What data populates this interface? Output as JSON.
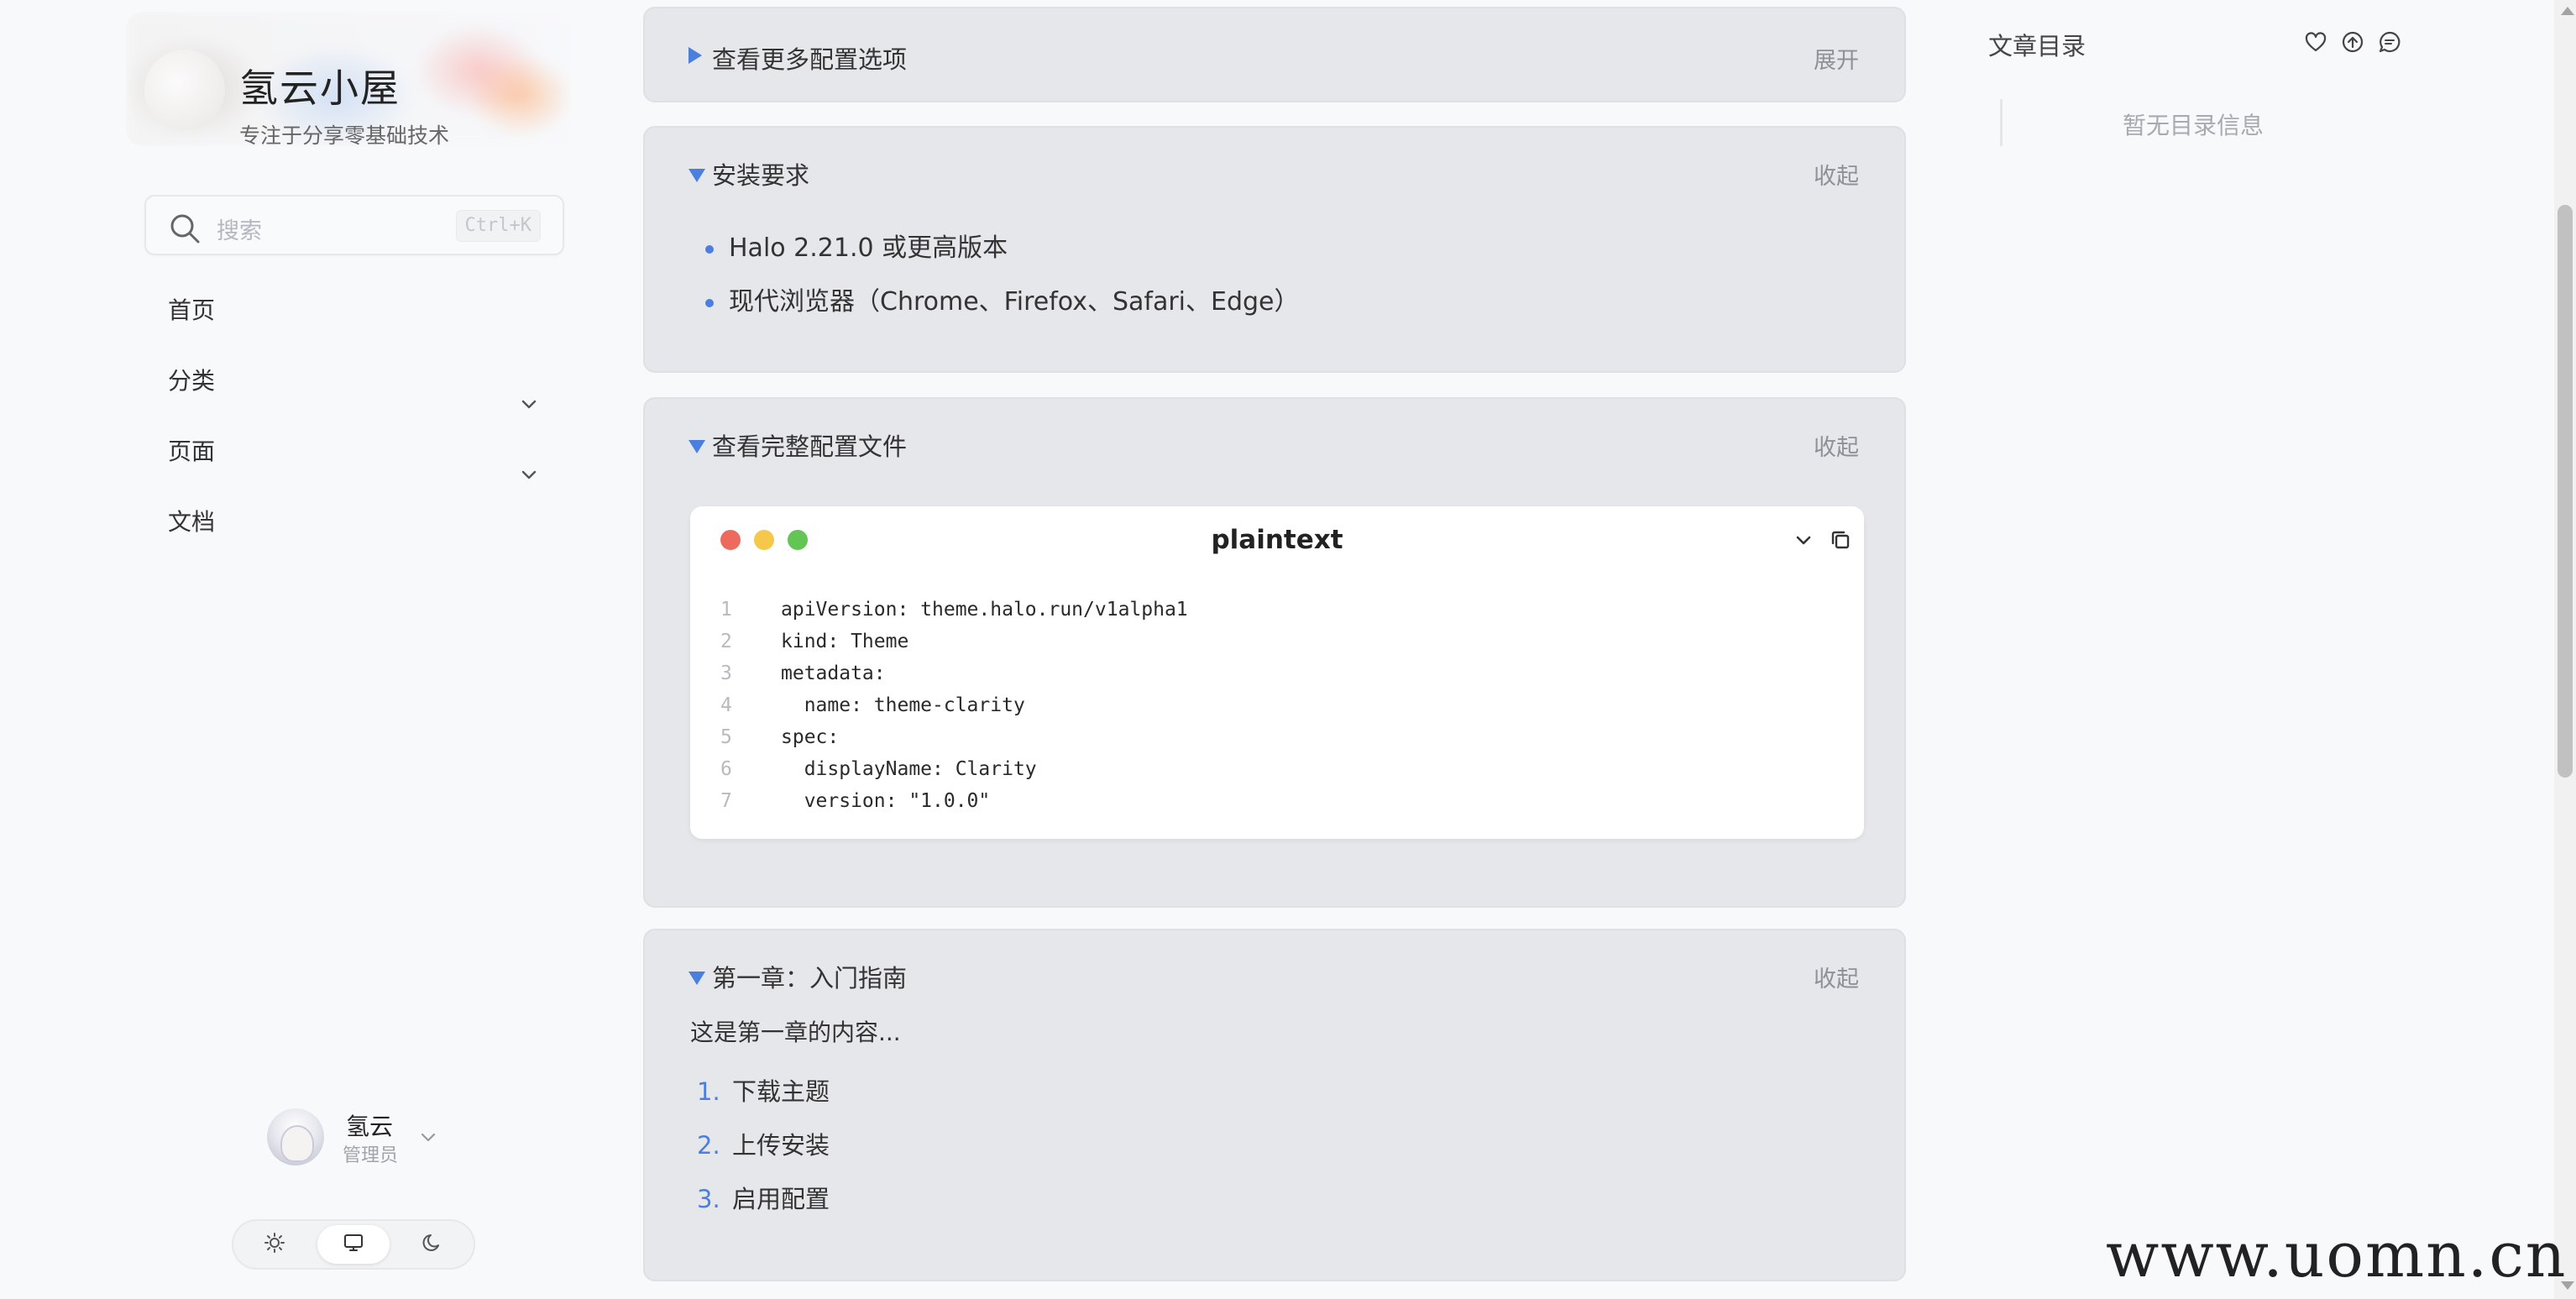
{
  "site": {
    "title": "氢云小屋",
    "subtitle": "专注于分享零基础技术"
  },
  "search": {
    "placeholder": "搜索",
    "shortcut": "Ctrl+K"
  },
  "nav": {
    "items": [
      {
        "label": "首页",
        "has_children": false
      },
      {
        "label": "分类",
        "has_children": true
      },
      {
        "label": "页面",
        "has_children": true
      },
      {
        "label": "文档",
        "has_children": false
      }
    ]
  },
  "user": {
    "name": "氢云",
    "role": "管理员"
  },
  "theme_switch": {
    "options": [
      "light-icon",
      "system-icon",
      "dark-icon"
    ],
    "selected": "system-icon"
  },
  "sections": {
    "more_config": {
      "title": "查看更多配置选项",
      "toggle": "展开",
      "expanded": false
    },
    "install": {
      "title": "安装要求",
      "toggle": "收起",
      "items": [
        "Halo 2.21.0 或更高版本",
        "现代浏览器（Chrome、Firefox、Safari、Edge）"
      ]
    },
    "full_config": {
      "title": "查看完整配置文件",
      "toggle": "收起",
      "code": {
        "language": "plaintext",
        "lines": [
          "apiVersion: theme.halo.run/v1alpha1",
          "kind: Theme",
          "metadata:",
          "  name: theme-clarity",
          "spec:",
          "  displayName: Clarity",
          "  version: \"1.0.0\""
        ]
      }
    },
    "chapter1": {
      "title": "第一章：入门指南",
      "toggle": "收起",
      "intro": "这是第一章的内容...",
      "items": [
        "下载主题",
        "上传安装",
        "启用配置"
      ]
    }
  },
  "toc": {
    "title": "文章目录",
    "empty": "暂无目录信息",
    "icons": [
      "heart-icon",
      "arrow-up-icon",
      "comment-icon"
    ]
  },
  "watermark": "www.uomn.cn",
  "colors": {
    "accent": "#4a7fe0",
    "card_bg": "#e6e7ea",
    "dot_red": "#ee6a5f",
    "dot_yellow": "#f5c84c",
    "dot_green": "#62c554"
  }
}
